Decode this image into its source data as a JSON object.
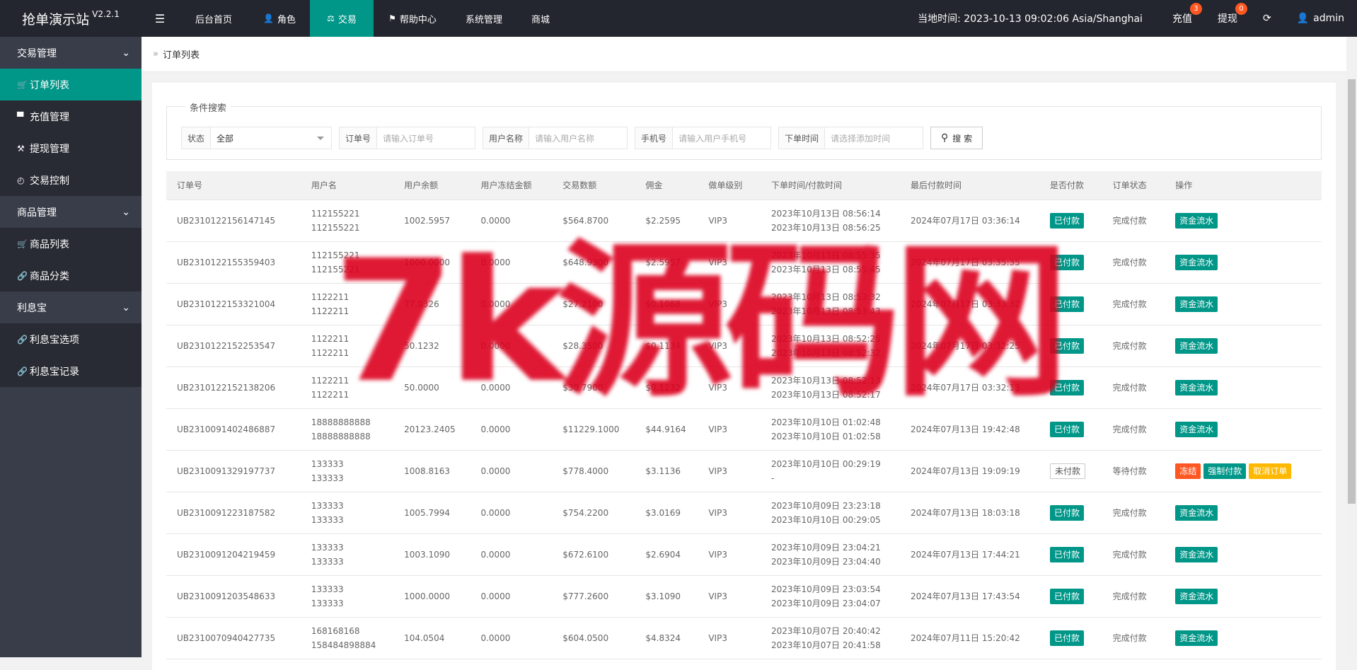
{
  "app": {
    "title": "抢单演示站",
    "version": "V2.2.1"
  },
  "nav": [
    {
      "label": "后台首页",
      "icon": ""
    },
    {
      "label": "角色",
      "icon": "user-icon"
    },
    {
      "label": "交易",
      "icon": "scale-icon",
      "active": true
    },
    {
      "label": "帮助中心",
      "icon": "flag-icon"
    },
    {
      "label": "系统管理",
      "icon": ""
    },
    {
      "label": "商城",
      "icon": ""
    }
  ],
  "header": {
    "clock": "当地时间: 2023-10-13 09:02:06   Asia/Shanghai",
    "recharge": "充值",
    "recharge_badge": "3",
    "withdraw": "提现",
    "withdraw_badge": "0",
    "user": "admin"
  },
  "sidebar": {
    "groups": [
      {
        "label": "交易管理",
        "items": [
          "订单列表",
          "充值管理",
          "提现管理",
          "交易控制"
        ]
      },
      {
        "label": "商品管理",
        "items": [
          "商品列表",
          "商品分类"
        ]
      },
      {
        "label": "利息宝",
        "items": [
          "利息宝选项",
          "利息宝记录"
        ]
      }
    ]
  },
  "breadcrumb": "订单列表",
  "search": {
    "legend": "条件搜索",
    "status_label": "状态",
    "status_value": "全部",
    "order_label": "订单号",
    "order_placeholder": "请输入订单号",
    "username_label": "用户名称",
    "username_placeholder": "请输入用户名称",
    "phone_label": "手机号",
    "phone_placeholder": "请输入用户手机号",
    "time_label": "下单时间",
    "time_placeholder": "请选择添加时间",
    "button": "搜 索"
  },
  "table": {
    "columns": [
      "订单号",
      "用户名",
      "用户余额",
      "用户冻结金额",
      "交易数额",
      "佣金",
      "做单级别",
      "下单时间/付款时间",
      "最后付款时间",
      "是否付款",
      "订单状态",
      "操作"
    ],
    "rows": [
      {
        "id": "UB2310122156147145",
        "user1": "112155221",
        "user2": "112155221",
        "balance": "1002.5957",
        "frozen": "0.0000",
        "amount": "$564.8700",
        "commission": "$2.2595",
        "level": "VIP3",
        "t1": "2023年10月13日 08:56:14",
        "t2": "2023年10月13日 08:56:25",
        "last": "2024年07月17日 03:36:14",
        "paid": "已付款",
        "status": "完成付款",
        "actions": [
          "资金流水"
        ]
      },
      {
        "id": "UB2310122155359403",
        "user1": "112155221",
        "user2": "112155221",
        "balance": "1000.0000",
        "frozen": "0.0000",
        "amount": "$648.9300",
        "commission": "$2.5957",
        "level": "VIP3",
        "t1": "2023年10月13日 08:55:35",
        "t2": "2023年10月13日 08:55:45",
        "last": "2024年07月17日 03:35:35",
        "paid": "已付款",
        "status": "完成付款",
        "actions": [
          "资金流水"
        ]
      },
      {
        "id": "UB2310122153321004",
        "user1": "1122211",
        "user2": "1122211",
        "balance": "77.0326",
        "frozen": "0.0000",
        "amount": "$27.2100",
        "commission": "$0.1088",
        "level": "VIP3",
        "t1": "2023年10月13日 08:53:32",
        "t2": "2023年10月13日 08:53:43",
        "last": "2024年07月17日 03:33:32",
        "paid": "已付款",
        "status": "完成付款",
        "actions": [
          "资金流水"
        ]
      },
      {
        "id": "UB2310122152253547",
        "user1": "1122211",
        "user2": "1122211",
        "balance": "50.1232",
        "frozen": "0.0000",
        "amount": "$28.3500",
        "commission": "$0.1134",
        "level": "VIP3",
        "t1": "2023年10月13日 08:52:25",
        "t2": "2023年10月13日 08:52:32",
        "last": "2024年07月17日 03:32:25",
        "paid": "已付款",
        "status": "完成付款",
        "actions": [
          "资金流水"
        ]
      },
      {
        "id": "UB2310122152138206",
        "user1": "1122211",
        "user2": "1122211",
        "balance": "50.0000",
        "frozen": "0.0000",
        "amount": "$30.7900",
        "commission": "$0.1232",
        "level": "VIP3",
        "t1": "2023年10月13日 08:52:13",
        "t2": "2023年10月13日 08:52:17",
        "last": "2024年07月17日 03:32:13",
        "paid": "已付款",
        "status": "完成付款",
        "actions": [
          "资金流水"
        ]
      },
      {
        "id": "UB2310091402486887",
        "user1": "18888888888",
        "user2": "18888888888",
        "balance": "20123.2405",
        "frozen": "0.0000",
        "amount": "$11229.1000",
        "commission": "$44.9164",
        "level": "VIP3",
        "t1": "2023年10月10日 01:02:48",
        "t2": "2023年10月10日 01:02:58",
        "last": "2024年07月13日 19:42:48",
        "paid": "已付款",
        "status": "完成付款",
        "actions": [
          "资金流水"
        ]
      },
      {
        "id": "UB2310091329197737",
        "user1": "133333",
        "user2": "133333",
        "balance": "1008.8163",
        "frozen": "0.0000",
        "amount": "$778.4000",
        "commission": "$3.1136",
        "level": "VIP3",
        "t1": "2023年10月10日 00:29:19",
        "t2": "-",
        "last": "2024年07月13日 19:09:19",
        "paid": "未付款",
        "status": "等待付款",
        "actions": [
          "冻结",
          "强制付款",
          "取消订单"
        ]
      },
      {
        "id": "UB2310091223187582",
        "user1": "133333",
        "user2": "133333",
        "balance": "1005.7994",
        "frozen": "0.0000",
        "amount": "$754.2200",
        "commission": "$3.0169",
        "level": "VIP3",
        "t1": "2023年10月09日 23:23:18",
        "t2": "2023年10月10日 00:29:05",
        "last": "2024年07月13日 18:03:18",
        "paid": "已付款",
        "status": "完成付款",
        "actions": [
          "资金流水"
        ]
      },
      {
        "id": "UB2310091204219459",
        "user1": "133333",
        "user2": "133333",
        "balance": "1003.1090",
        "frozen": "0.0000",
        "amount": "$672.6100",
        "commission": "$2.6904",
        "level": "VIP3",
        "t1": "2023年10月09日 23:04:21",
        "t2": "2023年10月09日 23:04:40",
        "last": "2024年07月13日 17:44:21",
        "paid": "已付款",
        "status": "完成付款",
        "actions": [
          "资金流水"
        ]
      },
      {
        "id": "UB2310091203548633",
        "user1": "133333",
        "user2": "133333",
        "balance": "1000.0000",
        "frozen": "0.0000",
        "amount": "$777.2600",
        "commission": "$3.1090",
        "level": "VIP3",
        "t1": "2023年10月09日 23:03:54",
        "t2": "2023年10月09日 23:04:07",
        "last": "2024年07月13日 17:43:54",
        "paid": "已付款",
        "status": "完成付款",
        "actions": [
          "资金流水"
        ]
      },
      {
        "id": "UB2310070940427735",
        "user1": "168168168",
        "user2": "158484898884",
        "balance": "104.0504",
        "frozen": "0.0000",
        "amount": "$604.0500",
        "commission": "$4.8324",
        "level": "VIP3",
        "t1": "2023年10月07日 20:40:42",
        "t2": "2023年10月07日 20:41:58",
        "last": "2024年07月11日 15:20:42",
        "paid": "已付款",
        "status": "完成付款",
        "actions": [
          "资金流水"
        ]
      }
    ]
  },
  "watermark": "7k源码网"
}
